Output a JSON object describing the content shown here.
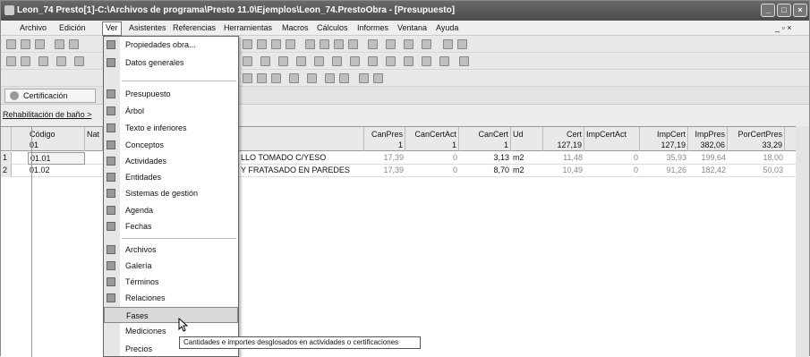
{
  "window": {
    "title": "Leon_74 Presto[1]-C:\\Archivos de programa\\Presto 11.0\\Ejemplos\\Leon_74.PrestoObra - [Presupuesto]"
  },
  "menubar": {
    "items": [
      "Archivo",
      "Edición",
      "Ver",
      "Asistentes",
      "Referencias",
      "Herramientas",
      "Macros",
      "Cálculos",
      "Informes",
      "Ventana",
      "Ayuda"
    ],
    "mdi_controls": "_ ▫ ×"
  },
  "tab": {
    "label": "Certificación"
  },
  "breadcrumb": "Rehabilitación de baño >",
  "grid": {
    "headers": {
      "codigo": "Código",
      "codigo_sub": "01",
      "nat": "Nat",
      "canpres": "CanPres",
      "canpres_sub": "1",
      "cancertact": "CanCertAct",
      "cancertact_sub": "1",
      "cancert": "CanCert",
      "cancert_sub": "1",
      "ud": "Ud",
      "cert": "Cert",
      "cert_sub": "127,19",
      "impcertact": "ImpCertAct",
      "impcert": "ImpCert",
      "impcert_sub": "127,19",
      "imppres": "ImpPres",
      "imppres_sub": "382,06",
      "porcertpres": "PorCertPres",
      "porcertpres_sub": "33,29"
    },
    "rows": [
      {
        "num": "1",
        "codigo": "01.01",
        "resumen": "LLO TOMADO C/YESO",
        "canpres": "17,39",
        "cancertact": "0",
        "cancert": "3,13",
        "ud": "m2",
        "cert": "11,48",
        "impcertact": "0",
        "impcert": "35,93",
        "imppres": "199,64",
        "porcertpres": "18,00"
      },
      {
        "num": "2",
        "codigo": "01.02",
        "resumen": "Y FRATASADO EN PAREDES",
        "canpres": "17,39",
        "cancertact": "0",
        "cancert": "8,70",
        "ud": "m2",
        "cert": "10,49",
        "impcertact": "0",
        "impcert": "91,26",
        "imppres": "182,42",
        "porcertpres": "50,03"
      }
    ]
  },
  "view_menu": {
    "items": [
      {
        "label": "Propiedades obra...",
        "icon": "properties-icon"
      },
      {
        "label": "Datos generales",
        "icon": "general-data-icon"
      },
      {
        "label": "Presupuesto",
        "icon": "budget-icon"
      },
      {
        "label": "Árbol",
        "icon": "tree-icon"
      },
      {
        "label": "Texto e inferiores",
        "icon": "text-icon"
      },
      {
        "label": "Conceptos",
        "icon": "concepts-icon"
      },
      {
        "label": "Actividades",
        "icon": "activities-icon"
      },
      {
        "label": "Entidades",
        "icon": "entities-icon"
      },
      {
        "label": "Sistemas de gestión",
        "icon": "management-icon"
      },
      {
        "label": "Agenda",
        "icon": "agenda-icon"
      },
      {
        "label": "Fechas",
        "icon": "dates-icon"
      },
      {
        "label": "Archivos",
        "icon": "files-icon"
      },
      {
        "label": "Galería",
        "icon": "gallery-icon"
      },
      {
        "label": "Términos",
        "icon": "terms-icon"
      },
      {
        "label": "Relaciones",
        "icon": "relations-icon"
      },
      {
        "label": "Fases",
        "icon": "phases-icon"
      },
      {
        "label": "Mediciones",
        "icon": "measurements-icon"
      },
      {
        "label": "Precios",
        "icon": "prices-icon"
      }
    ]
  },
  "tooltip": "Cantidades e importes desglosados en actividades o certificaciones"
}
